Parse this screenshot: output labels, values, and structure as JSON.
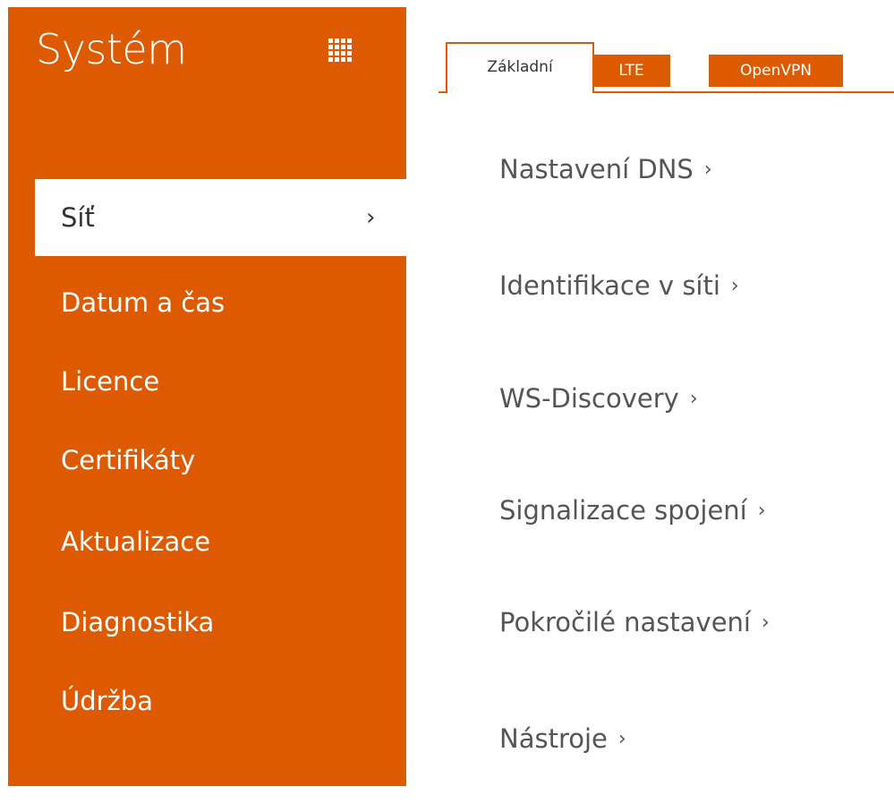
{
  "sidebar": {
    "title": "Systém",
    "apps_icon": "apps-grid-icon",
    "items": [
      {
        "label": "Síť",
        "active": true,
        "chevron": "›"
      },
      {
        "label": "Datum a čas"
      },
      {
        "label": "Licence"
      },
      {
        "label": "Certifikáty"
      },
      {
        "label": "Aktualizace"
      },
      {
        "label": "Diagnostika"
      },
      {
        "label": "Údržba"
      }
    ]
  },
  "tabs": [
    {
      "label": "Základní",
      "active": true
    },
    {
      "label": "LTE"
    },
    {
      "label": "OpenVPN"
    }
  ],
  "links": [
    {
      "label": "Nastavení DNS",
      "arrow": "›"
    },
    {
      "label": "Identifikace v síti",
      "arrow": "›"
    },
    {
      "label": "WS-Discovery",
      "arrow": "›"
    },
    {
      "label": "Signalizace spojení",
      "arrow": "›"
    },
    {
      "label": "Pokročilé nastavení",
      "arrow": "›"
    },
    {
      "label": "Nástroje",
      "arrow": "›"
    }
  ],
  "colors": {
    "accent": "#de5a00",
    "text_dark": "#333333",
    "text_link": "#555555",
    "background": "#ffffff"
  }
}
